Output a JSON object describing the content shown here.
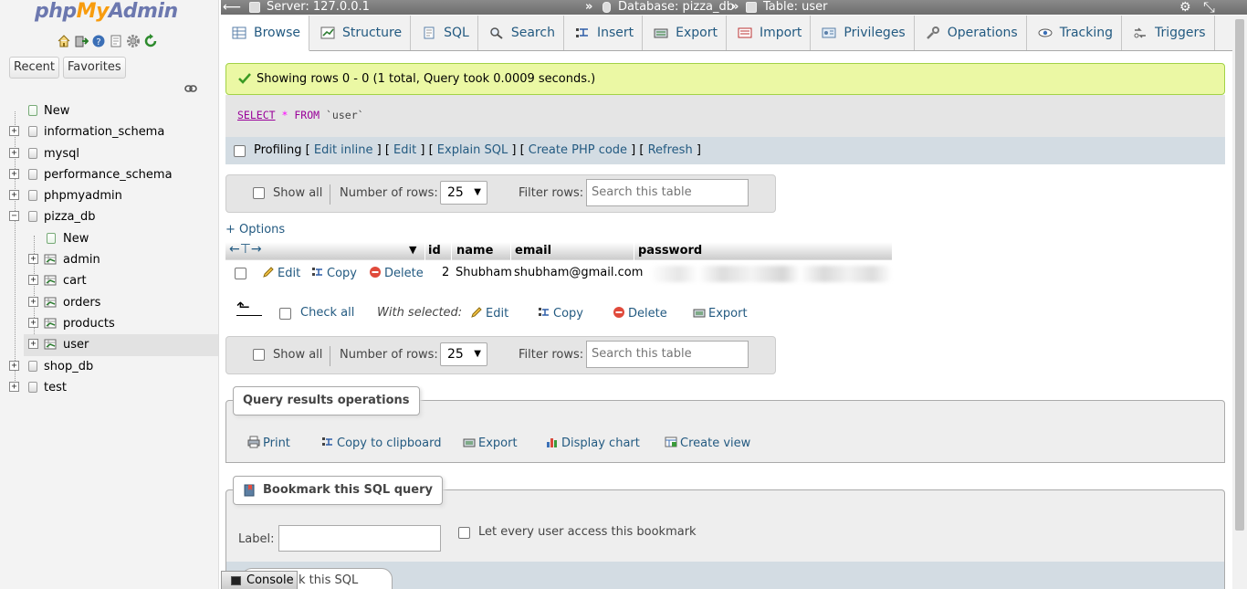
{
  "app": {
    "logo_php": "php",
    "logo_my": "My",
    "logo_admin": "Admin"
  },
  "nav": {
    "tabs": [
      "Recent",
      "Favorites"
    ],
    "tree": [
      {
        "label": "New",
        "level": 0,
        "kind": "new"
      },
      {
        "label": "information_schema",
        "level": 0,
        "kind": "db"
      },
      {
        "label": "mysql",
        "level": 0,
        "kind": "db"
      },
      {
        "label": "performance_schema",
        "level": 0,
        "kind": "db"
      },
      {
        "label": "phpmyadmin",
        "level": 0,
        "kind": "db"
      },
      {
        "label": "pizza_db",
        "level": 0,
        "kind": "db-open"
      },
      {
        "label": "New",
        "level": 1,
        "kind": "new"
      },
      {
        "label": "admin",
        "level": 1,
        "kind": "table"
      },
      {
        "label": "cart",
        "level": 1,
        "kind": "table"
      },
      {
        "label": "orders",
        "level": 1,
        "kind": "table"
      },
      {
        "label": "products",
        "level": 1,
        "kind": "table"
      },
      {
        "label": "user",
        "level": 1,
        "kind": "table",
        "selected": true
      },
      {
        "label": "shop_db",
        "level": 0,
        "kind": "db"
      },
      {
        "label": "test",
        "level": 0,
        "kind": "db"
      }
    ]
  },
  "breadcrumb": {
    "server": "Server: 127.0.0.1",
    "database": "Database: pizza_db",
    "table": "Table: user",
    "sep": "»"
  },
  "tabs": [
    {
      "label": "Browse",
      "icon": "browse-icon",
      "active": true
    },
    {
      "label": "Structure",
      "icon": "structure-icon"
    },
    {
      "label": "SQL",
      "icon": "sql-icon"
    },
    {
      "label": "Search",
      "icon": "search-icon"
    },
    {
      "label": "Insert",
      "icon": "insert-icon"
    },
    {
      "label": "Export",
      "icon": "export-icon"
    },
    {
      "label": "Import",
      "icon": "import-icon"
    },
    {
      "label": "Privileges",
      "icon": "privileges-icon"
    },
    {
      "label": "Operations",
      "icon": "operations-icon"
    },
    {
      "label": "Tracking",
      "icon": "tracking-icon"
    },
    {
      "label": "Triggers",
      "icon": "triggers-icon"
    }
  ],
  "result": {
    "message": "Showing rows 0 - 0 (1 total, Query took 0.0009 seconds.)",
    "sql": {
      "select": "SELECT",
      "star": "*",
      "from": "FROM",
      "table": "`user`"
    },
    "profiling": "Profiling",
    "links": [
      "Edit inline",
      "Edit",
      "Explain SQL",
      "Create PHP code",
      "Refresh"
    ]
  },
  "table_nav": {
    "show_all": "Show all",
    "num_rows_label": "Number of rows:",
    "num_rows_value": "25",
    "filter_label": "Filter rows:",
    "filter_placeholder": "Search this table"
  },
  "options_link": "+ Options",
  "grid": {
    "columns": [
      "id",
      "name",
      "email",
      "password"
    ],
    "row": {
      "edit": "Edit",
      "copy": "Copy",
      "delete": "Delete",
      "id": "2",
      "name": "Shubham",
      "email": "shubham@gmail.com"
    }
  },
  "with_selected": {
    "check_all": "Check all",
    "label": "With selected:",
    "actions": [
      "Edit",
      "Copy",
      "Delete",
      "Export"
    ]
  },
  "query_ops": {
    "title": "Query results operations",
    "actions": [
      "Print",
      "Copy to clipboard",
      "Export",
      "Display chart",
      "Create view"
    ]
  },
  "bookmark": {
    "title": "Bookmark this SQL query",
    "label": "Label:",
    "share": "Let every user access this bookmark",
    "button_partial": "k this SQL query"
  },
  "console": "Console",
  "colors": {
    "link": "#235a81",
    "success_bg": "#ebf8a4",
    "tab_bg": "#f1f1f1",
    "header_bar": "#7a7a7a"
  }
}
